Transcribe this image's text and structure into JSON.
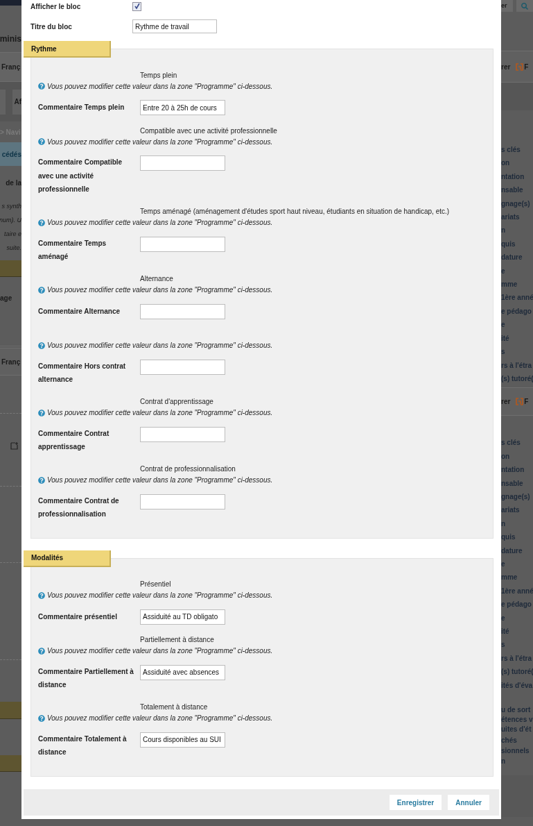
{
  "background_page": {
    "left": {
      "header": "minis",
      "language": "Franç",
      "tab": "Af",
      "breadcrumb": "> Navi",
      "notice": "cédés",
      "heading": "de la",
      "intro_lines": [
        "s synth",
        "num). U",
        "taire e",
        "suite."
      ],
      "section_label": "age",
      "language_2": "Franç"
    },
    "right": {
      "top_button": "er",
      "action": "rer",
      "logo_text": "F",
      "action_2": "rer",
      "logo_text_2": "F",
      "menu_1": [
        "s clés",
        "on",
        "ntation",
        "nsable",
        "gnage(s)",
        "ariats",
        "n",
        "quis",
        "dature",
        "e",
        "mme",
        "1ère anné",
        "e pédago",
        "e",
        "ité",
        "s",
        "rs à l'étra",
        "(s) tutoré("
      ],
      "menu_2": [
        "s clés",
        "on",
        "ntation",
        "nsable",
        "gnage(s)",
        "ariats",
        "n",
        "quis",
        "dature",
        "e",
        "mme",
        "1ère anné",
        "e pédago",
        "e",
        "ité",
        "s",
        "rs à l'étra",
        "(s) tutoré(",
        "ités d'éva"
      ],
      "menu_3": [
        "u de sort",
        "étences v",
        "uites d'ét",
        "chés",
        "sionnels",
        "n"
      ]
    }
  },
  "dialog": {
    "show_block": {
      "label": "Afficher le bloc",
      "checked": true
    },
    "block_title": {
      "label": "Titre du bloc",
      "value": "Rythme de travail"
    },
    "sections": [
      {
        "legend": "Rythme",
        "fields": [
          {
            "title": "Temps plein",
            "help": "Vous pouvez modifier cette valeur dans la zone \"Programme\" ci-dessous.",
            "label": "Commentaire Temps plein",
            "value": "Entre 20 à 25h de cours"
          },
          {
            "title": "Compatible avec une activité professionnelle",
            "help": "Vous pouvez modifier cette valeur dans la zone \"Programme\" ci-dessous.",
            "label": "Commentaire Compatible avec une activité professionnelle"
          },
          {
            "title": "Temps aménagé (aménagement d'études sport haut niveau, étudiants en situation de handicap, etc.)",
            "help": "Vous pouvez modifier cette valeur dans la zone \"Programme\" ci-dessous.",
            "label": "Commentaire Temps aménagé"
          },
          {
            "title": "Alternance",
            "help": "Vous pouvez modifier cette valeur dans la zone \"Programme\" ci-dessous.",
            "label": "Commentaire Alternance"
          },
          {
            "help": "Vous pouvez modifier cette valeur dans la zone \"Programme\" ci-dessous.",
            "label": "Commentaire Hors contrat alternance"
          },
          {
            "title": "Contrat d'apprentissage",
            "help": "Vous pouvez modifier cette valeur dans la zone \"Programme\" ci-dessous.",
            "label": "Commentaire Contrat apprentissage"
          },
          {
            "title": "Contrat de professionnalisation",
            "help": "Vous pouvez modifier cette valeur dans la zone \"Programme\" ci-dessous.",
            "label": "Commentaire Contrat de professionnalisation"
          }
        ]
      },
      {
        "legend": "Modalités",
        "fields": [
          {
            "title": "Présentiel",
            "help": "Vous pouvez modifier cette valeur dans la zone \"Programme\" ci-dessous.",
            "label": "Commentaire présentiel",
            "value": "Assiduité au TD obligato"
          },
          {
            "title": "Partiellement à distance",
            "help": "Vous pouvez modifier cette valeur dans la zone \"Programme\" ci-dessous.",
            "label": "Commentaire Partiellement à distance",
            "value": "Assiduité avec absences"
          },
          {
            "title": "Totalement à distance",
            "help": "Vous pouvez modifier cette valeur dans la zone \"Programme\" ci-dessous.",
            "label": "Commentaire Totalement à distance",
            "value": "Cours disponibles au SUI"
          }
        ]
      }
    ],
    "buttons": [
      "Enregistrer",
      "Annuler"
    ]
  }
}
